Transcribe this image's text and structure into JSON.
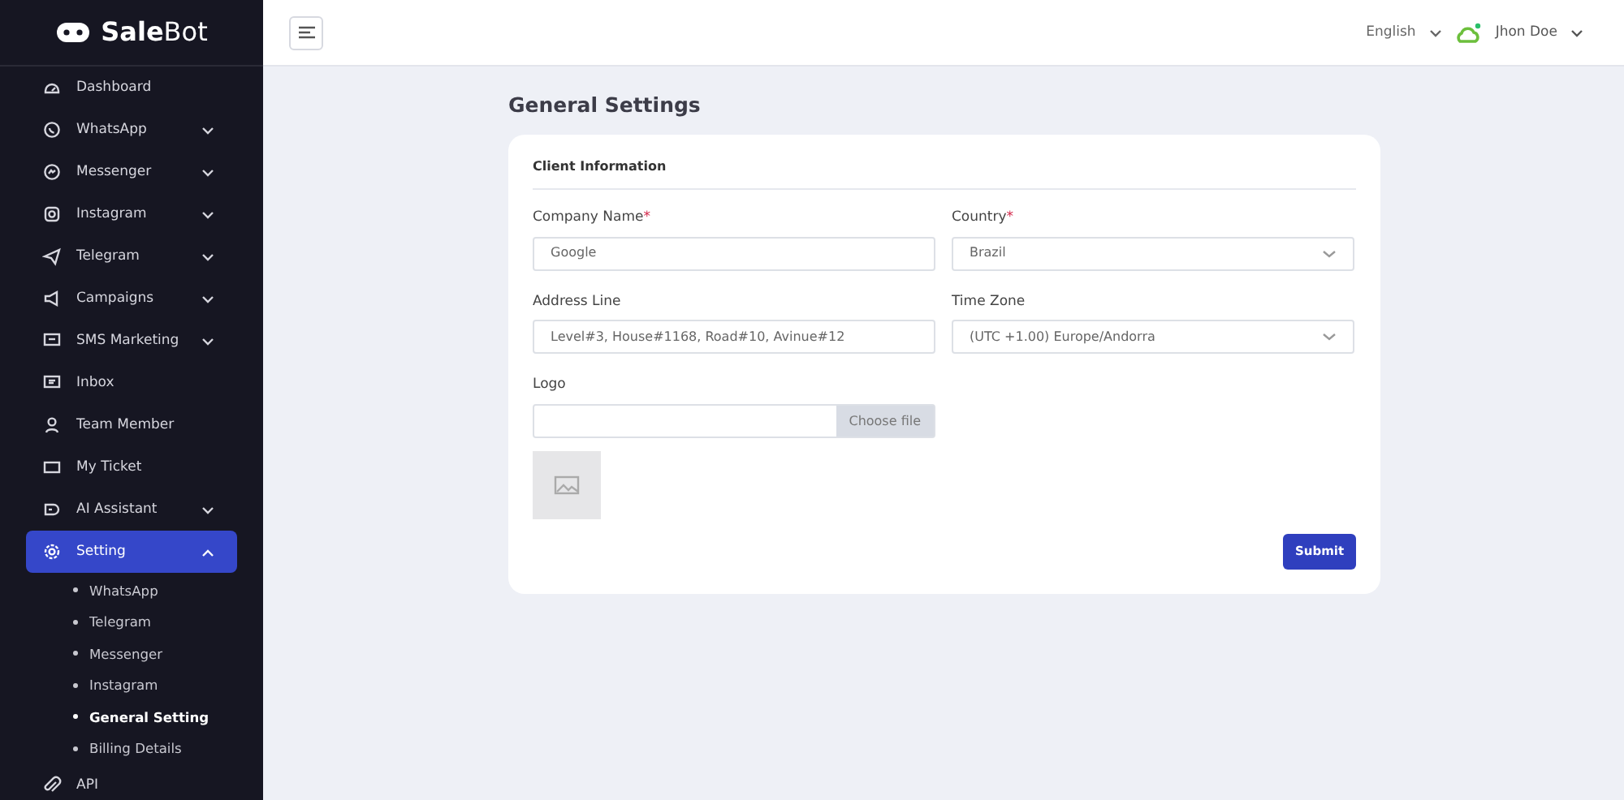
{
  "brand": {
    "name_bold": "Sale",
    "name_light": "Bot"
  },
  "sidebar": {
    "items": [
      {
        "label": "Dashboard",
        "selected": false
      },
      {
        "label": "WhatsApp",
        "selected": false,
        "expanded": false
      },
      {
        "label": "Messenger",
        "selected": false,
        "expanded": false
      },
      {
        "label": "Instagram",
        "selected": false,
        "expanded": false
      },
      {
        "label": "Telegram",
        "selected": false,
        "expanded": false
      },
      {
        "label": "Campaigns",
        "selected": false,
        "expanded": false
      },
      {
        "label": "SMS Marketing",
        "selected": false,
        "expanded": false
      },
      {
        "label": "Inbox",
        "selected": false
      },
      {
        "label": "Team Member",
        "selected": false
      },
      {
        "label": "My Ticket",
        "selected": false
      },
      {
        "label": "AI Assistant",
        "selected": false,
        "expanded": false
      },
      {
        "label": "Setting",
        "selected": true,
        "expanded": true,
        "children": [
          {
            "label": "WhatsApp",
            "selected": false
          },
          {
            "label": "Telegram",
            "selected": false
          },
          {
            "label": "Messenger",
            "selected": false
          },
          {
            "label": "Instagram",
            "selected": false
          },
          {
            "label": "General Setting",
            "selected": true
          },
          {
            "label": "Billing Details",
            "selected": false
          }
        ]
      },
      {
        "label": "API",
        "selected": false
      }
    ]
  },
  "header": {
    "language": "English",
    "user": "Jhon Doe"
  },
  "page": {
    "title": "General Settings"
  },
  "card": {
    "title": "Client Information",
    "fields": [
      {
        "kind": "text",
        "label": "Company Name",
        "required_mark": "*",
        "value": "Google"
      },
      {
        "kind": "select",
        "label": "Country",
        "required_mark": "*",
        "value": "Brazil"
      },
      {
        "kind": "text",
        "label": "Address Line",
        "value": "Level#3, House#1168, Road#10, Avinue#12"
      },
      {
        "kind": "select",
        "label": "Time Zone",
        "value": "(UTC +1.00) Europe/Andorra"
      },
      {
        "kind": "file",
        "label": "Logo",
        "button": "Choose file"
      }
    ],
    "submit": "Submit"
  }
}
